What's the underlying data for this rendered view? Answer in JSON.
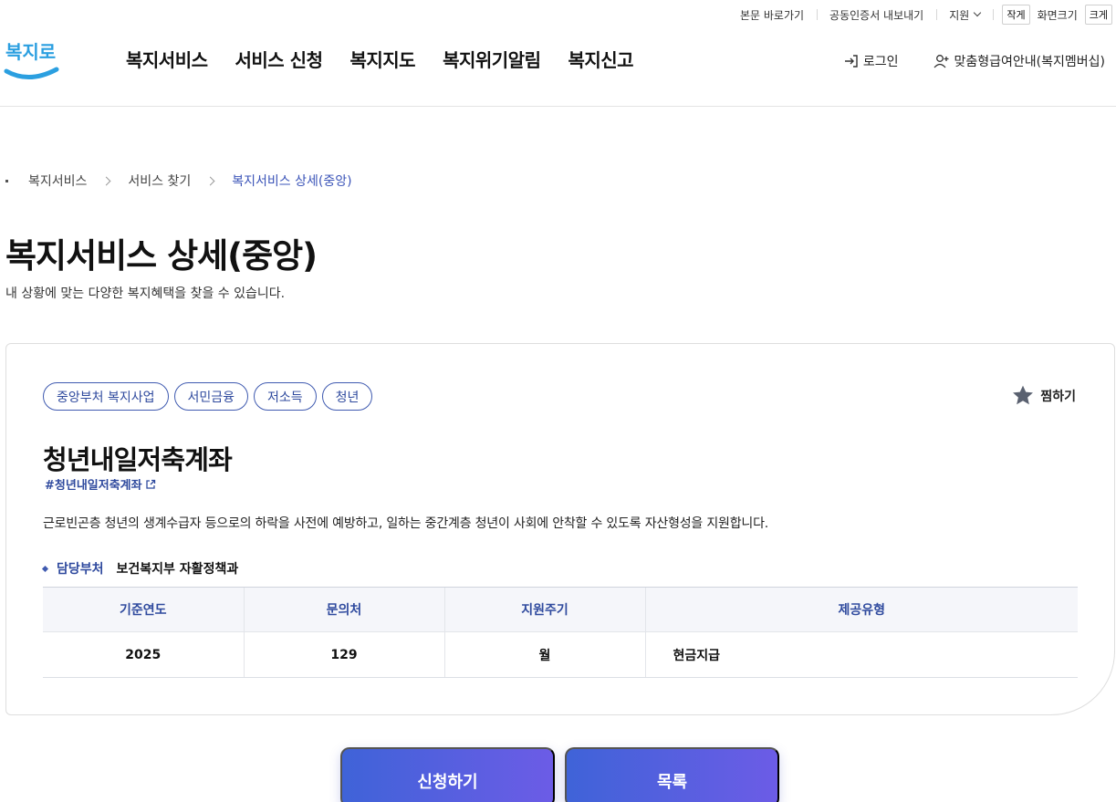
{
  "utility": {
    "skip_link": "본문 바로가기",
    "cert_export": "공동인증서 내보내기",
    "support": "지원",
    "font_small": "작게",
    "font_label": "화면크기",
    "font_large": "크게"
  },
  "logo": {
    "text": "복지로",
    "accent_color": "#2fa3e6"
  },
  "gnb": [
    "복지서비스",
    "서비스 신청",
    "복지지도",
    "복지위기알림",
    "복지신고"
  ],
  "header_right": {
    "login": "로그인",
    "membership": "맞춤형급여안내(복지멤버십)"
  },
  "breadcrumb": [
    "복지서비스",
    "서비스 찾기",
    "복지서비스 상세(중앙)"
  ],
  "page": {
    "title": "복지서비스 상세(중앙)",
    "description": "내 상황에 맞는 다양한 복지혜택을 찾을 수 있습니다."
  },
  "service": {
    "tags": [
      "중앙부처 복지사업",
      "서민금융",
      "저소득",
      "청년"
    ],
    "bookmark": "찜하기",
    "title": "청년내일저축계좌",
    "hashtag": "#청년내일저축계좌",
    "description": "근로빈곤층 청년의 생계수급자 등으로의 하락을 사전에 예방하고, 일하는 중간계층 청년이 사회에 안착할 수 있도록 자산형성을 지원합니다.",
    "dept_label": "담당부처",
    "dept_value": "보건복지부 자활정책과",
    "table": {
      "headers": [
        "기준연도",
        "문의처",
        "지원주기",
        "제공유형"
      ],
      "row": [
        "2025",
        "129",
        "월",
        "현금지급"
      ]
    }
  },
  "buttons": {
    "apply": "신청하기",
    "list": "목록"
  },
  "colors": {
    "primary": "#3f5ab0",
    "button_gradient_start": "#3f63d8",
    "button_gradient_end": "#6c5ce6"
  }
}
